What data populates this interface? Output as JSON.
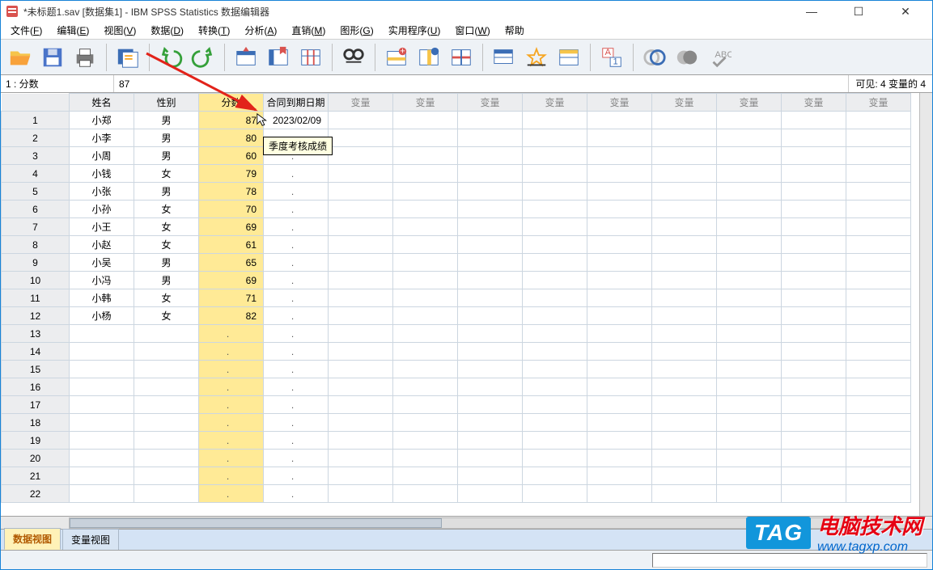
{
  "window": {
    "title": "*未标题1.sav [数据集1] - IBM SPSS Statistics 数据编辑器"
  },
  "menu": {
    "items": [
      {
        "label": "文件",
        "key": "F"
      },
      {
        "label": "编辑",
        "key": "E"
      },
      {
        "label": "视图",
        "key": "V"
      },
      {
        "label": "数据",
        "key": "D"
      },
      {
        "label": "转换",
        "key": "T"
      },
      {
        "label": "分析",
        "key": "A"
      },
      {
        "label": "直销",
        "key": "M"
      },
      {
        "label": "图形",
        "key": "G"
      },
      {
        "label": "实用程序",
        "key": "U"
      },
      {
        "label": "窗口",
        "key": "W"
      },
      {
        "label": "帮助"
      }
    ]
  },
  "toolbar": {
    "buttons": [
      {
        "name": "open-icon"
      },
      {
        "name": "save-icon"
      },
      {
        "name": "print-icon"
      },
      {
        "sep": true
      },
      {
        "name": "recall-dialog-icon"
      },
      {
        "sep": true
      },
      {
        "name": "undo-icon"
      },
      {
        "name": "redo-icon"
      },
      {
        "sep": true
      },
      {
        "name": "goto-case-icon"
      },
      {
        "name": "goto-variable-icon"
      },
      {
        "name": "variables-icon"
      },
      {
        "sep": true
      },
      {
        "name": "find-icon"
      },
      {
        "sep": true
      },
      {
        "name": "insert-case-icon"
      },
      {
        "name": "insert-variable-icon"
      },
      {
        "name": "split-file-icon"
      },
      {
        "sep": true
      },
      {
        "name": "weight-cases-icon"
      },
      {
        "name": "select-cases-icon"
      },
      {
        "name": "value-labels-icon"
      },
      {
        "sep": true
      },
      {
        "name": "use-sets-icon"
      },
      {
        "sep": true
      },
      {
        "name": "show-all-icon"
      },
      {
        "name": "show-selected-icon"
      },
      {
        "name": "spell-check-icon"
      }
    ]
  },
  "cell_info": {
    "label": "1 : 分数",
    "value": "87"
  },
  "visible_info": "可见:  4 变量的 4",
  "columns": [
    {
      "label": "姓名",
      "type": "data"
    },
    {
      "label": "性别",
      "type": "data"
    },
    {
      "label": "分数",
      "type": "data",
      "selected": true
    },
    {
      "label": "合同到期日期",
      "type": "data"
    },
    {
      "label": "变量",
      "type": "var"
    },
    {
      "label": "变量",
      "type": "var"
    },
    {
      "label": "变量",
      "type": "var"
    },
    {
      "label": "变量",
      "type": "var"
    },
    {
      "label": "变量",
      "type": "var"
    },
    {
      "label": "变量",
      "type": "var"
    },
    {
      "label": "变量",
      "type": "var"
    },
    {
      "label": "变量",
      "type": "var"
    },
    {
      "label": "变量",
      "type": "var"
    }
  ],
  "rows": [
    {
      "n": 1,
      "name": "小郑",
      "gender": "男",
      "score": "87",
      "date": "2023/02/09"
    },
    {
      "n": 2,
      "name": "小李",
      "gender": "男",
      "score": "80",
      "date": "."
    },
    {
      "n": 3,
      "name": "小周",
      "gender": "男",
      "score": "60",
      "date": "."
    },
    {
      "n": 4,
      "name": "小钱",
      "gender": "女",
      "score": "79",
      "date": "."
    },
    {
      "n": 5,
      "name": "小张",
      "gender": "男",
      "score": "78",
      "date": "."
    },
    {
      "n": 6,
      "name": "小孙",
      "gender": "女",
      "score": "70",
      "date": "."
    },
    {
      "n": 7,
      "name": "小王",
      "gender": "女",
      "score": "69",
      "date": "."
    },
    {
      "n": 8,
      "name": "小赵",
      "gender": "女",
      "score": "61",
      "date": "."
    },
    {
      "n": 9,
      "name": "小吴",
      "gender": "男",
      "score": "65",
      "date": "."
    },
    {
      "n": 10,
      "name": "小冯",
      "gender": "男",
      "score": "69",
      "date": "."
    },
    {
      "n": 11,
      "name": "小韩",
      "gender": "女",
      "score": "71",
      "date": "."
    },
    {
      "n": 12,
      "name": "小杨",
      "gender": "女",
      "score": "82",
      "date": "."
    }
  ],
  "empty_rows": [
    13,
    14,
    15,
    16,
    17,
    18,
    19,
    20,
    21,
    22
  ],
  "tooltip": "季度考核成绩",
  "tabs": {
    "data_view": "数据视图",
    "variable_view": "变量视图"
  },
  "watermark": {
    "tag": "TAG",
    "cn": "电脑技术网",
    "url": "www.tagxp.com"
  }
}
